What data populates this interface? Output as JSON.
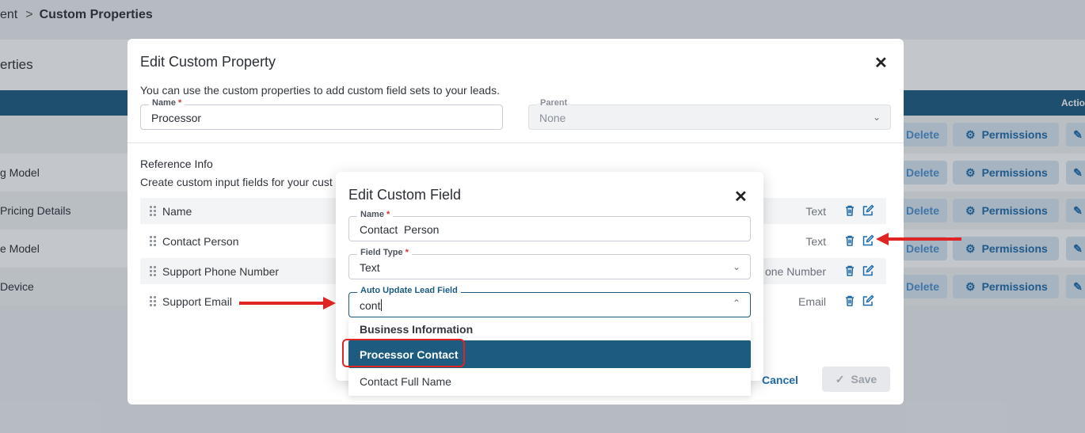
{
  "breadcrumb": {
    "previous": "ent",
    "separator": ">",
    "current": "Custom Properties"
  },
  "background": {
    "card_title": "erties",
    "header_action": "Actio",
    "rows": [
      {
        "label": ""
      },
      {
        "label": "g Model"
      },
      {
        "label": "Pricing Details"
      },
      {
        "label": "e Model"
      },
      {
        "label": "Device"
      }
    ],
    "delete_label": "Delete",
    "permissions_label": "Permissions"
  },
  "edit_property": {
    "title": "Edit Custom Property",
    "description": "You can use the custom properties to add custom field sets to your leads.",
    "name_label": "Name",
    "required_mark": "*",
    "name_value": "Processor",
    "parent_label": "Parent",
    "parent_value": "None",
    "reference_title": "Reference Info",
    "reference_desc": "Create custom input fields for your cust",
    "fields": [
      {
        "name": "Name",
        "type": "Text"
      },
      {
        "name": "Contact Person",
        "type": "Text"
      },
      {
        "name": "Support Phone Number",
        "type": "one Number"
      },
      {
        "name": "Support Email",
        "type": "Email"
      }
    ],
    "cancel_label": "Cancel",
    "save_label": "Save"
  },
  "edit_field": {
    "title": "Edit Custom Field",
    "name_label": "Name",
    "name_value": "Contact  Person",
    "field_type_label": "Field Type",
    "field_type_value": "Text",
    "auto_update_label": "Auto Update Lead Field",
    "auto_update_value": "cont",
    "dropdown": {
      "group": "Business Information",
      "selected": "Processor Contact",
      "option": "Contact Full Name"
    }
  },
  "colors": {
    "primary": "#1d5b80",
    "accent_light": "#d7e6f3",
    "annotation": "#e02424"
  }
}
